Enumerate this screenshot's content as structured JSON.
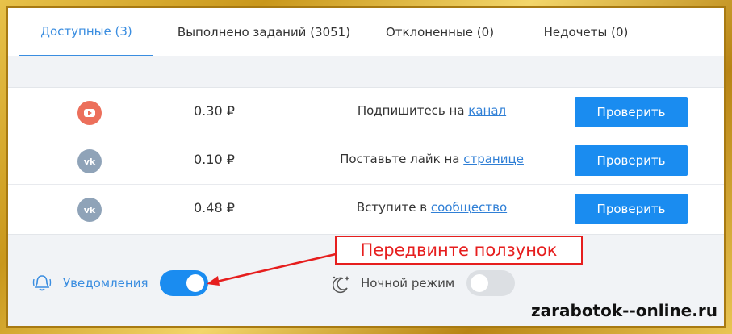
{
  "tabs": [
    {
      "label": "Доступные (3)",
      "active": true
    },
    {
      "label": "Выполнено заданий (3051)",
      "active": false
    },
    {
      "label": "Отклоненные (0)",
      "active": false
    },
    {
      "label": "Недочеты (0)",
      "active": false
    }
  ],
  "tasks": [
    {
      "service": "youtube-icon",
      "price": "0.30 ₽",
      "text": "Подпишитесь на ",
      "link": "канал",
      "button": "Проверить"
    },
    {
      "service": "vk-icon",
      "price": "0.10 ₽",
      "text": "Поставьте лайк на ",
      "link": "странице",
      "button": "Проверить"
    },
    {
      "service": "vk-icon",
      "price": "0.48 ₽",
      "text": "Вступите в ",
      "link": "сообщество",
      "button": "Проверить"
    }
  ],
  "settings": {
    "notifications": {
      "label": "Уведомления",
      "enabled": true
    },
    "night_mode": {
      "label": "Ночной режим",
      "enabled": false
    }
  },
  "annotation": {
    "callout": "Передвинте ползунок"
  },
  "watermark": "zarabotok--online.ru",
  "colors": {
    "accent": "#1a8cf0",
    "callout": "#e61e1e",
    "frame": "#c9971b"
  }
}
